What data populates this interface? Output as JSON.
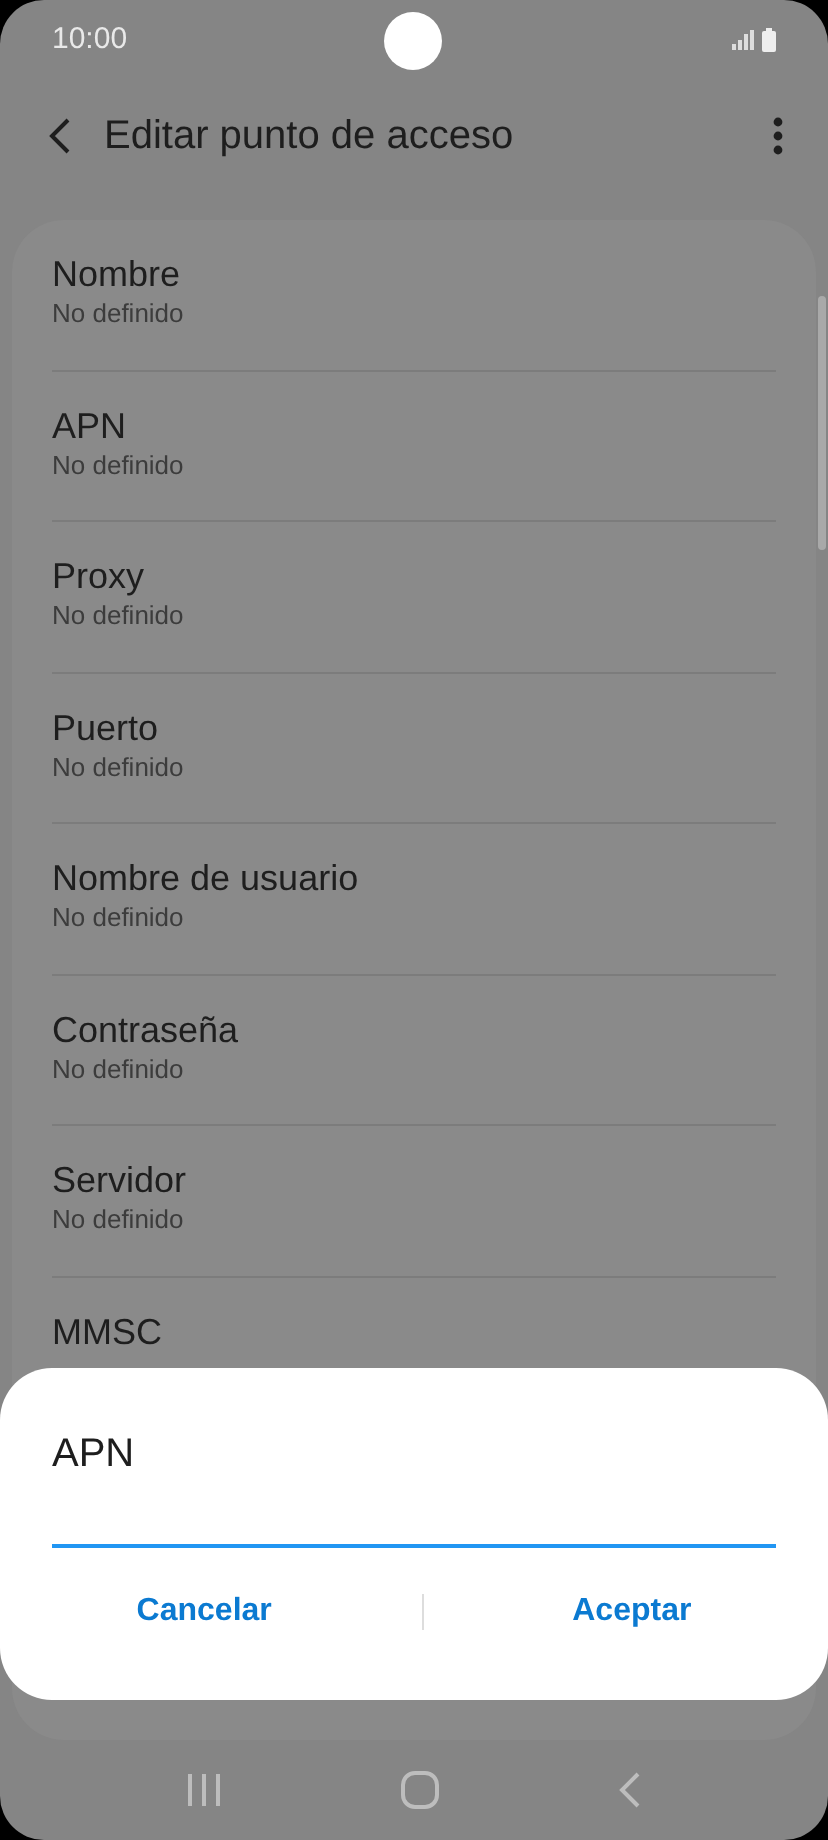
{
  "status_bar": {
    "time": "10:00"
  },
  "app_bar": {
    "title": "Editar punto de acceso"
  },
  "settings": [
    {
      "title": "Nombre",
      "value": "No definido"
    },
    {
      "title": "APN",
      "value": "No definido"
    },
    {
      "title": "Proxy",
      "value": "No definido"
    },
    {
      "title": "Puerto",
      "value": "No definido"
    },
    {
      "title": "Nombre de usuario",
      "value": "No definido"
    },
    {
      "title": "Contraseña",
      "value": "No definido"
    },
    {
      "title": "Servidor",
      "value": "No definido"
    },
    {
      "title": "MMSC"
    }
  ],
  "dialog": {
    "title": "APN",
    "buttons": [
      "Cancelar",
      "Aceptar"
    ]
  }
}
